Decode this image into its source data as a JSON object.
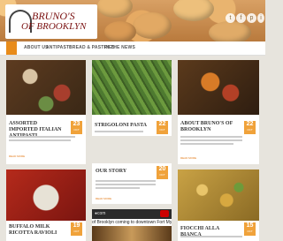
{
  "header": {
    "logo_line1": "BRUNO'S",
    "logo_line2": "OF BROOKLYN",
    "social": [
      "twitter-icon",
      "facebook-icon",
      "pinterest-icon",
      "instagram-icon"
    ]
  },
  "nav": {
    "items": [
      {
        "label": "ABOUT US"
      },
      {
        "label": "ANTIPASTI"
      },
      {
        "label": "BREAD & PASTRIES"
      },
      {
        "label": "IN THE NEWS"
      }
    ]
  },
  "posts": [
    {
      "title": "ASSORTED IMPORTED ITALIAN ANTIPASTI",
      "day": "23",
      "month": "OCT"
    },
    {
      "title": "STRIGOLONI PASTA",
      "day": "22",
      "month": "OCT"
    },
    {
      "title": "ABOUT BRUNO'S OF BROOKLYN",
      "day": "22",
      "month": "OCT"
    },
    {
      "title": "OUR STORY",
      "day": "20",
      "month": "OCT"
    },
    {
      "title": "BUFFALO MILK RICOTTA RAVIOLI",
      "day": "19",
      "month": "OCT"
    },
    {
      "title": "FIOCCHI ALLA BIANCA",
      "day": "15",
      "month": "OCT"
    }
  ],
  "video": {
    "caption": "of Brooklyn coming to downtown Fort My"
  },
  "labels": {
    "read_more": "READ MORE"
  }
}
